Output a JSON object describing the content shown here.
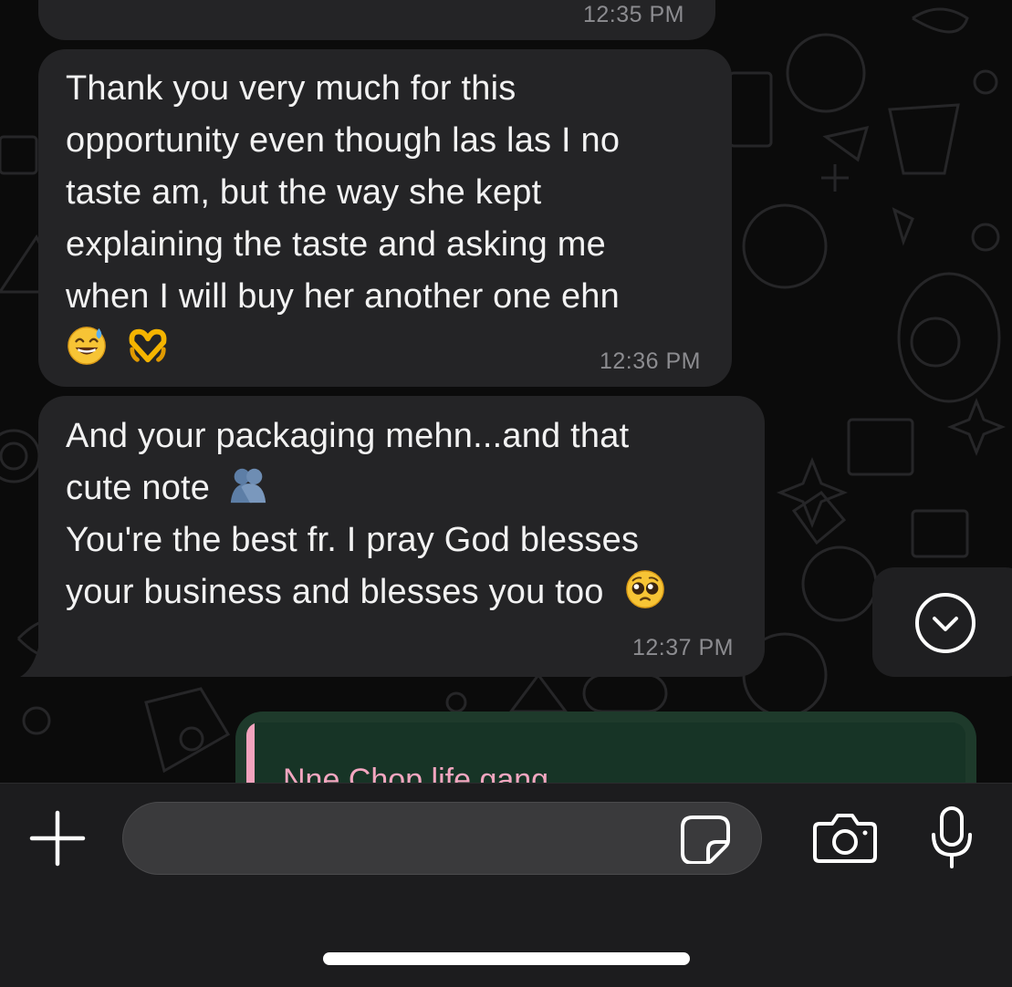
{
  "messages": [
    {
      "id": "msg-1",
      "direction": "incoming",
      "time": "12:35 PM"
    },
    {
      "id": "msg-2",
      "direction": "incoming",
      "lines": [
        "Thank you very much for this",
        "opportunity even though las las I no",
        "taste am, but the way she kept",
        "explaining the taste and asking me",
        "when I will buy her another one ehn"
      ],
      "emojis": [
        "😅",
        "🫶"
      ],
      "time": "12:36 PM"
    },
    {
      "id": "msg-3",
      "direction": "incoming",
      "lines": [
        "And your packaging mehn...and that",
        "cute note",
        "You're the best fr. I pray God blesses",
        "your business and blesses you too"
      ],
      "emojis": [
        "🫂",
        "🥺"
      ],
      "time": "12:37 PM"
    },
    {
      "id": "msg-4",
      "direction": "outgoing",
      "quote_author": "Nne Chop life gang"
    }
  ],
  "icons": {
    "scroll_down": "chevron-down-circle-icon",
    "attach": "plus-icon",
    "sticker": "sticker-icon",
    "camera": "camera-icon",
    "microphone": "microphone-icon"
  },
  "colors": {
    "chat_background": "#0b0b0b",
    "incoming_bubble": "#242426",
    "outgoing_bubble": "#1e3a2b",
    "quote_accent": "#f2a3bd",
    "timestamp": "#8c8c90",
    "composer_background": "#1c1c1e"
  }
}
